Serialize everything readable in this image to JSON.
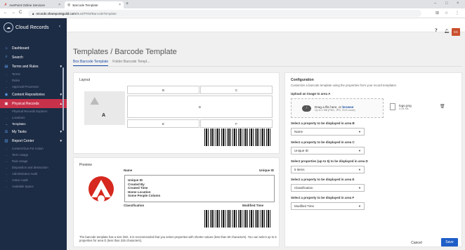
{
  "browser": {
    "tabs": [
      {
        "label": "AvePoint Online Services"
      },
      {
        "label": "Barcode Template"
      }
    ],
    "address": {
      "domain": "records.sharepointguild.com",
      "path": "/Bust/PRM/BarcodeTemplate"
    }
  },
  "app": {
    "name": "Cloud Records",
    "avatar_initials": "CC"
  },
  "sidebar": {
    "items": [
      {
        "label": "Dashboard",
        "icon": "home-icon",
        "type": "main"
      },
      {
        "label": "Search",
        "icon": "search-icon",
        "type": "main"
      },
      {
        "label": "Terms and Rules",
        "icon": "doc-icon",
        "type": "main",
        "expand": true
      },
      {
        "label": "Terms",
        "type": "sub"
      },
      {
        "label": "Rules",
        "type": "sub"
      },
      {
        "label": "Approval Processes",
        "type": "sub"
      },
      {
        "label": "Content Repositories",
        "icon": "database-icon",
        "type": "main",
        "expand": true
      },
      {
        "label": "Physical Records",
        "icon": "box-icon",
        "type": "main",
        "expand": true,
        "active": true
      },
      {
        "label": "Physical Records Explorer",
        "type": "sub"
      },
      {
        "label": "Locations",
        "type": "sub"
      },
      {
        "label": "Templates",
        "type": "sub",
        "current": true
      },
      {
        "label": "My Tasks",
        "icon": "tasks-icon",
        "type": "main",
        "expand": true
      },
      {
        "label": "Report Center",
        "icon": "report-icon",
        "type": "main",
        "expand": true
      },
      {
        "label": "Content Due For Action",
        "type": "sub"
      },
      {
        "label": "Term Usage",
        "type": "sub"
      },
      {
        "label": "Rule Usage",
        "type": "sub"
      },
      {
        "label": "Disposition and destruction",
        "type": "sub"
      },
      {
        "label": "Administrator Audit",
        "type": "sub"
      },
      {
        "label": "Action Audit",
        "type": "sub"
      },
      {
        "label": "Available Space",
        "type": "sub"
      }
    ]
  },
  "page": {
    "title": "Templates  /  Barcode Template",
    "tabs": [
      {
        "label": "Box Barcode Template",
        "active": true
      },
      {
        "label": "Folder Barcode Templ..."
      }
    ]
  },
  "layout": {
    "title": "Layout",
    "image_letter": "A",
    "areas": {
      "b": "B",
      "c": "C",
      "d": "D",
      "e": "E",
      "f": "F"
    }
  },
  "preview": {
    "title": "Preview",
    "name_label": "Name",
    "unique_id_label": "Unique ID",
    "d_lines": [
      "Unique ID",
      "Created By",
      "Created Time",
      "Home Location",
      "Some People Column"
    ],
    "classification_label": "Classification",
    "modified_label": "Modified Time",
    "note": "The barcode template has a size limit. It is recommended that you select properties with shorter values (less than 60 characters). You can select up to 5 properties for area D (less than 325 characters)."
  },
  "config": {
    "title": "Configuration",
    "subtitle": "Customize a barcode template using the properties from your record templates.",
    "upload_label": "Upload an image to area A",
    "drop_text": "Drag a file here, or",
    "browse": "browse",
    "drop_hint": "Up to 1 MB (PNG, JPG, SVG mode)",
    "file_name": "logo.png",
    "file_size": "4.34 KB",
    "fields": [
      {
        "label": "Select a property to be displayed in area B",
        "value": "Name"
      },
      {
        "label": "Select a property to be displayed in area C",
        "value": "Unique ID"
      },
      {
        "label": "Select properties (up to 5) to be displayed in area D",
        "value": "5 items"
      },
      {
        "label": "Select a property to be displayed in area E",
        "value": "Classification"
      },
      {
        "label": "Select a property to be displayed in area F",
        "value": "Modified Time"
      }
    ]
  },
  "actions": {
    "cancel": "Cancel",
    "save": "Save"
  },
  "colors": {
    "sidebar": "#1d2c45",
    "accent": "#1f5ec7",
    "highlight": "#c8314a",
    "logo_red": "#d6281e"
  }
}
